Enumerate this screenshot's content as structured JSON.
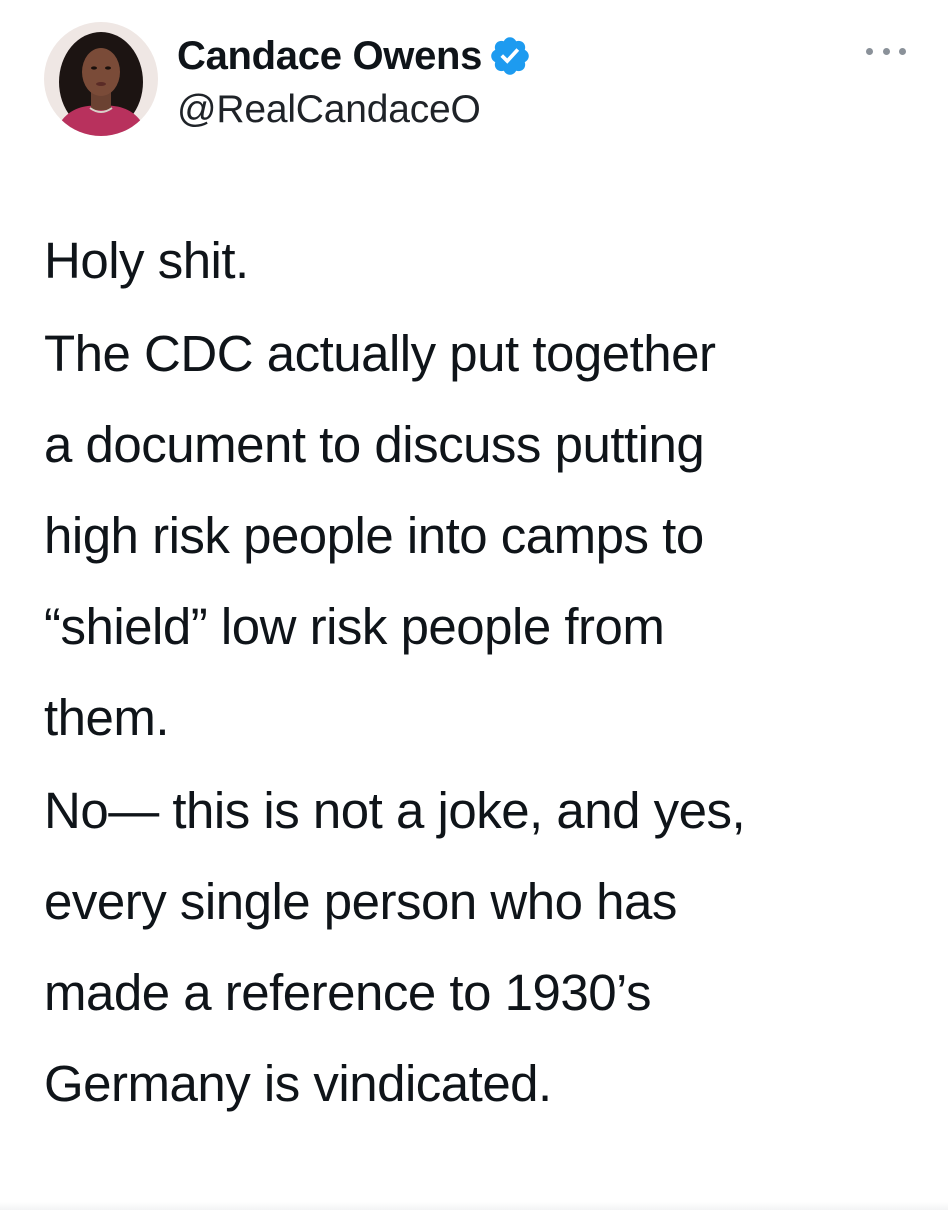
{
  "tweet": {
    "author": {
      "display_name": "Candace Owens",
      "handle": "@RealCandaceO",
      "verified": true,
      "verified_icon": "verified-badge-icon",
      "avatar_icon": "profile-photo"
    },
    "more_icon": "more-options-icon",
    "paragraphs": [
      {
        "lines": [
          "Holy shit."
        ]
      },
      {
        "lines": [
          "The CDC actually put together",
          "a document to discuss putting",
          "high risk people into camps to",
          "“shield” low risk people from",
          "them."
        ]
      },
      {
        "lines": [
          "No— this is not a joke, and yes,",
          "every single person who has",
          "made a reference to 1930’s",
          "Germany is vindicated."
        ]
      }
    ]
  },
  "colors": {
    "text": "#0f1419",
    "verified_blue": "#1d9bf0",
    "muted": "#8a9199"
  }
}
